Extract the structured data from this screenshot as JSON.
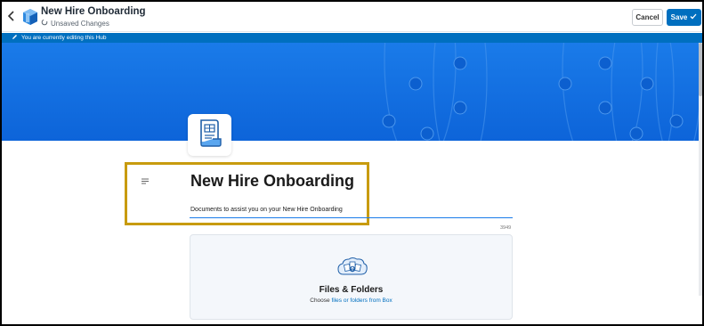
{
  "header": {
    "title": "New Hire Onboarding",
    "status": "Unsaved Changes",
    "cancel_label": "Cancel",
    "save_label": "Save"
  },
  "banner": {
    "text": "You are currently editing this Hub"
  },
  "hub": {
    "title": "New Hire Onboarding",
    "description": "Documents to assist you on your New Hire Onboarding",
    "char_count": "3949"
  },
  "files_card": {
    "title": "Files & Folders",
    "subtitle_prefix": "Choose ",
    "subtitle_link": "files or folders from Box"
  },
  "colors": {
    "accent": "#006fbf",
    "hero": "#1a7be9",
    "highlight": "#c89b0e"
  },
  "icons": {
    "back": "chevron-left-icon",
    "app": "hub-cube-icon",
    "sync": "sync-icon",
    "check": "checkmark-icon",
    "pencil": "pencil-icon",
    "document": "document-icon",
    "drag": "drag-handle-icon",
    "files": "files-folders-icon"
  }
}
